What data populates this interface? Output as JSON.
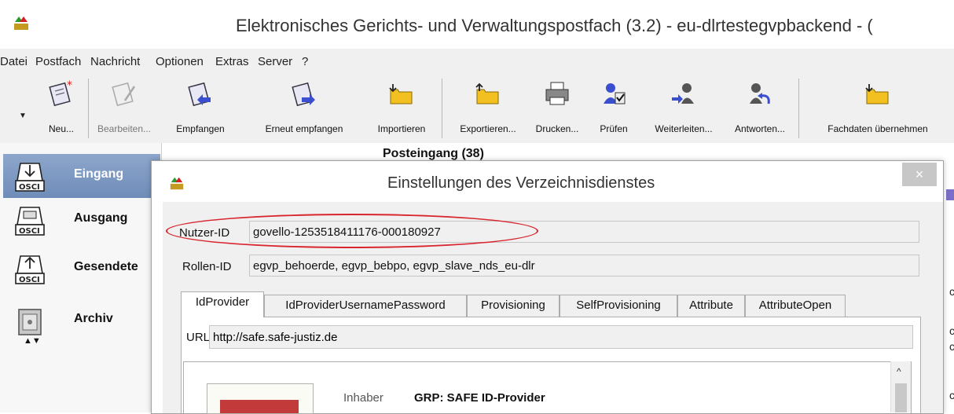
{
  "window": {
    "title": "Elektronisches Gerichts- und Verwaltungspostfach (3.2) - eu-dlrtestegvpbackend - ("
  },
  "menu": [
    "Datei",
    "Postfach",
    "Nachricht",
    "Optionen",
    "Extras",
    "Server",
    "?"
  ],
  "toolbar": [
    {
      "label": "Neu...",
      "icon": "new-message-icon",
      "enabled": true
    },
    {
      "label": "Bearbeiten...",
      "icon": "edit-message-icon",
      "enabled": false
    },
    {
      "label": "Empfangen",
      "icon": "receive-icon",
      "enabled": true
    },
    {
      "label": "Erneut empfangen",
      "icon": "receive-again-icon",
      "enabled": true
    },
    {
      "label": "Importieren",
      "icon": "import-folder-icon",
      "enabled": true
    },
    {
      "label": "Exportieren...",
      "icon": "export-folder-icon",
      "enabled": true
    },
    {
      "label": "Drucken...",
      "icon": "printer-icon",
      "enabled": true
    },
    {
      "label": "Prüfen",
      "icon": "verify-icon",
      "enabled": true
    },
    {
      "label": "Weiterleiten...",
      "icon": "forward-icon",
      "enabled": true
    },
    {
      "label": "Antworten...",
      "icon": "reply-icon",
      "enabled": true
    },
    {
      "label": "Fachdaten übernehmen",
      "icon": "take-data-icon",
      "enabled": true
    }
  ],
  "nav": [
    {
      "label": "Eingang",
      "icon": "inbox-osci-icon",
      "selected": true
    },
    {
      "label": "Ausgang",
      "icon": "outbox-osci-icon",
      "selected": false
    },
    {
      "label": "Gesendete",
      "icon": "sent-osci-icon",
      "selected": false
    },
    {
      "label": "Archiv",
      "icon": "archive-safe-icon",
      "selected": false
    }
  ],
  "main": {
    "folder_title": "Posteingang (38)"
  },
  "right_strip_chars": [
    "c",
    "c",
    "c",
    "c"
  ],
  "dialog": {
    "title": "Einstellungen des Verzeichnisdienstes",
    "close": "×",
    "nutzer_label": "Nutzer-ID",
    "nutzer_value": "govello-1253518411176-000180927",
    "rollen_label": "Rollen-ID",
    "rollen_value": "egvp_behoerde, egvp_bebpo, egvp_slave_nds_eu-dlr",
    "tabs": [
      "IdProvider",
      "IdProviderUsernamePassword",
      "Provisioning",
      "SelfProvisioning",
      "Attribute",
      "AttributeOpen"
    ],
    "active_tab": "IdProvider",
    "url_label": "URL",
    "url_value": "http://safe.safe-justiz.de",
    "inhaber_label": "Inhaber",
    "inhaber_value": "GRP: SAFE ID-Provider"
  },
  "colors": {
    "selection": "#7a93bf",
    "highlight_ellipse": "#d9262e"
  }
}
